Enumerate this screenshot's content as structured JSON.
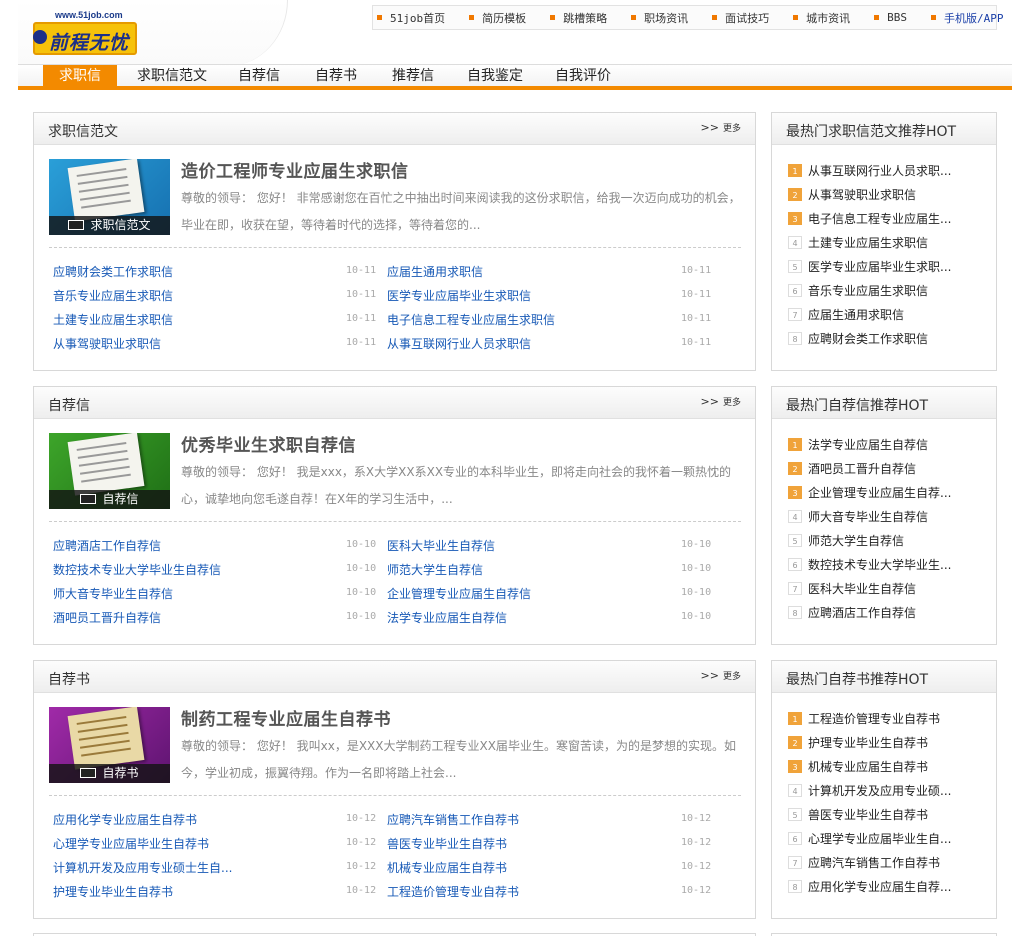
{
  "logo": {
    "url": "www.51job.com",
    "name": "前程无忧"
  },
  "top_nav": [
    "51job首页",
    "简历模板",
    "跳槽策略",
    "职场资讯",
    "面试技巧",
    "城市资讯",
    "BBS",
    "手机版/APP"
  ],
  "main_nav": [
    "求职信",
    "求职信范文",
    "自荐信",
    "自荐书",
    "推荐信",
    "自我鉴定",
    "自我评价"
  ],
  "colors": {
    "accent": "#f38a00",
    "link": "#1759b6",
    "hot_badge": "#f0a33a"
  },
  "more_label": "更多",
  "sections": [
    {
      "title": "求职信范文",
      "thumb_caption": "求职信范文",
      "featured_title": "造价工程师专业应届生求职信",
      "featured_desc": "尊敬的领导：  您好！  非常感谢您在百忙之中抽出时间来阅读我的这份求职信，给我一次迈向成功的机会，毕业在即，收获在望，等待着时代的选择，等待着您的...",
      "links": [
        {
          "text": "应聘财会类工作求职信",
          "date": "10-11"
        },
        {
          "text": "应届生通用求职信",
          "date": "10-11"
        },
        {
          "text": "音乐专业应届生求职信",
          "date": "10-11"
        },
        {
          "text": "医学专业应届毕业生求职信",
          "date": "10-11"
        },
        {
          "text": "土建专业应届生求职信",
          "date": "10-11"
        },
        {
          "text": "电子信息工程专业应届生求职信",
          "date": "10-11"
        },
        {
          "text": "从事驾驶职业求职信",
          "date": "10-11"
        },
        {
          "text": "从事互联网行业人员求职信",
          "date": "10-11"
        }
      ]
    },
    {
      "title": "自荐信",
      "thumb_caption": "自荐信",
      "featured_title": "优秀毕业生求职自荐信",
      "featured_desc": "尊敬的领导：  您好！  我是xxx，系X大学XX系XX专业的本科毕业生，即将走向社会的我怀着一颗热忱的心，诚挚地向您毛遂自荐！在X年的学习生活中，...",
      "links": [
        {
          "text": "应聘酒店工作自荐信",
          "date": "10-10"
        },
        {
          "text": "医科大毕业生自荐信",
          "date": "10-10"
        },
        {
          "text": "数控技术专业大学毕业生自荐信",
          "date": "10-10"
        },
        {
          "text": "师范大学生自荐信",
          "date": "10-10"
        },
        {
          "text": "师大音专毕业生自荐信",
          "date": "10-10"
        },
        {
          "text": "企业管理专业应届生自荐信",
          "date": "10-10"
        },
        {
          "text": "酒吧员工晋升自荐信",
          "date": "10-10"
        },
        {
          "text": "法学专业应届生自荐信",
          "date": "10-10"
        }
      ]
    },
    {
      "title": "自荐书",
      "thumb_caption": "自荐书",
      "featured_title": "制药工程专业应届生自荐书",
      "featured_desc": "尊敬的领导：  您好！  我叫xx，是XXX大学制药工程专业XX届毕业生。寒窗苦读，为的是梦想的实现。如今，学业初成，振翼待翔。作为一名即将踏上社会...",
      "links": [
        {
          "text": "应用化学专业应届生自荐书",
          "date": "10-12"
        },
        {
          "text": "应聘汽车销售工作自荐书",
          "date": "10-12"
        },
        {
          "text": "心理学专业应届毕业生自荐书",
          "date": "10-12"
        },
        {
          "text": "兽医专业毕业生自荐书",
          "date": "10-12"
        },
        {
          "text": "计算机开发及应用专业硕士生自...",
          "date": "10-12"
        },
        {
          "text": "机械专业应届生自荐书",
          "date": "10-12"
        },
        {
          "text": "护理专业毕业生自荐书",
          "date": "10-12"
        },
        {
          "text": "工程造价管理专业自荐书",
          "date": "10-12"
        }
      ]
    }
  ],
  "sidebars": [
    {
      "title": "最热门求职信范文推荐HOT",
      "items": [
        "从事互联网行业人员求职...",
        "从事驾驶职业求职信",
        "电子信息工程专业应届生...",
        "土建专业应届生求职信",
        "医学专业应届毕业生求职...",
        "音乐专业应届生求职信",
        "应届生通用求职信",
        "应聘财会类工作求职信"
      ]
    },
    {
      "title": "最热门自荐信推荐HOT",
      "items": [
        "法学专业应届生自荐信",
        "酒吧员工晋升自荐信",
        "企业管理专业应届生自荐...",
        "师大音专毕业生自荐信",
        "师范大学生自荐信",
        "数控技术专业大学毕业生...",
        "医科大毕业生自荐信",
        "应聘酒店工作自荐信"
      ]
    },
    {
      "title": "最热门自荐书推荐HOT",
      "items": [
        "工程造价管理专业自荐书",
        "护理专业毕业生自荐书",
        "机械专业应届生自荐书",
        "计算机开发及应用专业硕...",
        "兽医专业毕业生自荐书",
        "心理学专业应届毕业生自...",
        "应聘汽车销售工作自荐书",
        "应用化学专业应届生自荐..."
      ]
    }
  ]
}
